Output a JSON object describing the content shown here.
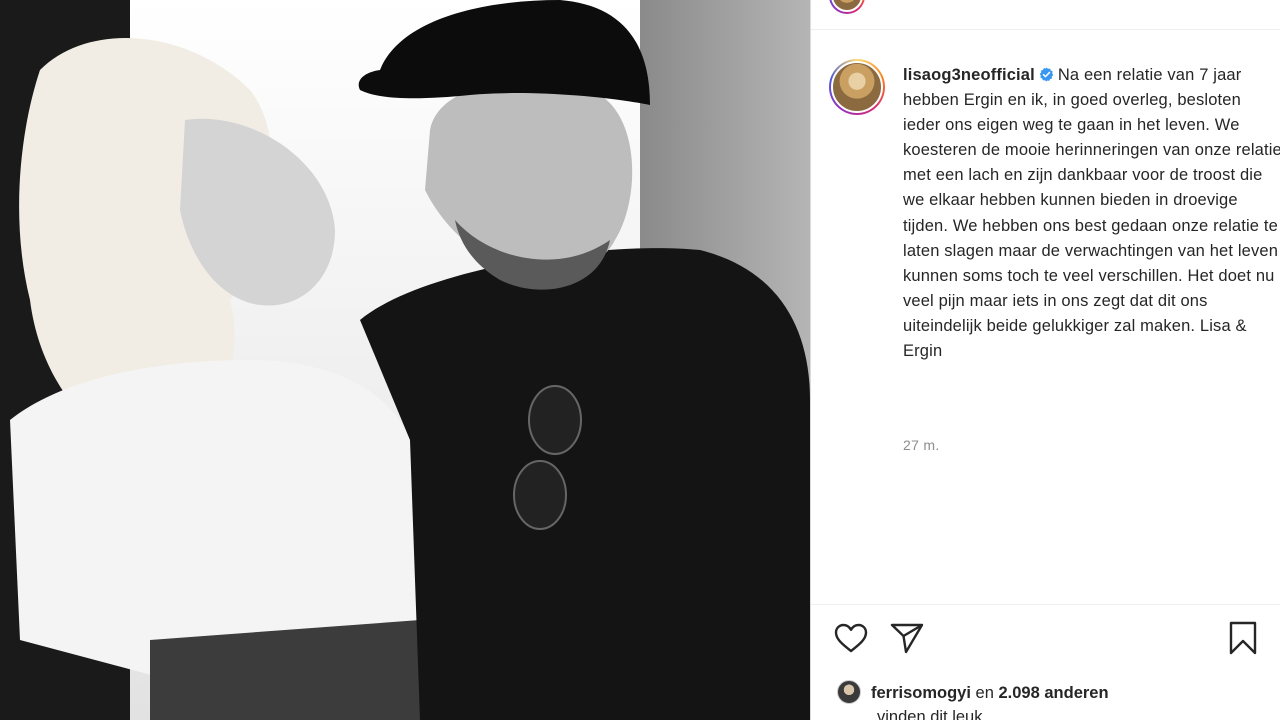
{
  "post": {
    "username": "lisaog3neofficial",
    "verified_icon": "verified-badge-icon",
    "caption": "Na een relatie van 7 jaar hebben Ergin en ik, in goed overleg, besloten ieder ons eigen weg te gaan in het leven. We koesteren de mooie herinneringen van onze relatie met een lach en zijn dankbaar voor de troost die we elkaar hebben kunnen bieden in droevige tijden. We hebben ons best gedaan onze relatie te laten slagen maar de verwachtingen van het leven kunnen soms toch te veel verschillen. Het doet nu veel pijn maar iets in ons zegt dat dit ons uiteindelijk beide gelukkiger zal maken. Lisa & Ergin",
    "timestamp": "27 m."
  },
  "actions": {
    "like_icon": "heart-icon",
    "share_icon": "paper-plane-icon",
    "save_icon": "bookmark-icon"
  },
  "likes": {
    "first_user": "ferrisomogyi",
    "connector": "en",
    "others": "2.098 anderen",
    "suffix": "vinden dit leuk"
  },
  "colors": {
    "text": "#262626",
    "muted": "#8e8e8e",
    "verified": "#3897f0",
    "border": "#dbdbdb"
  }
}
